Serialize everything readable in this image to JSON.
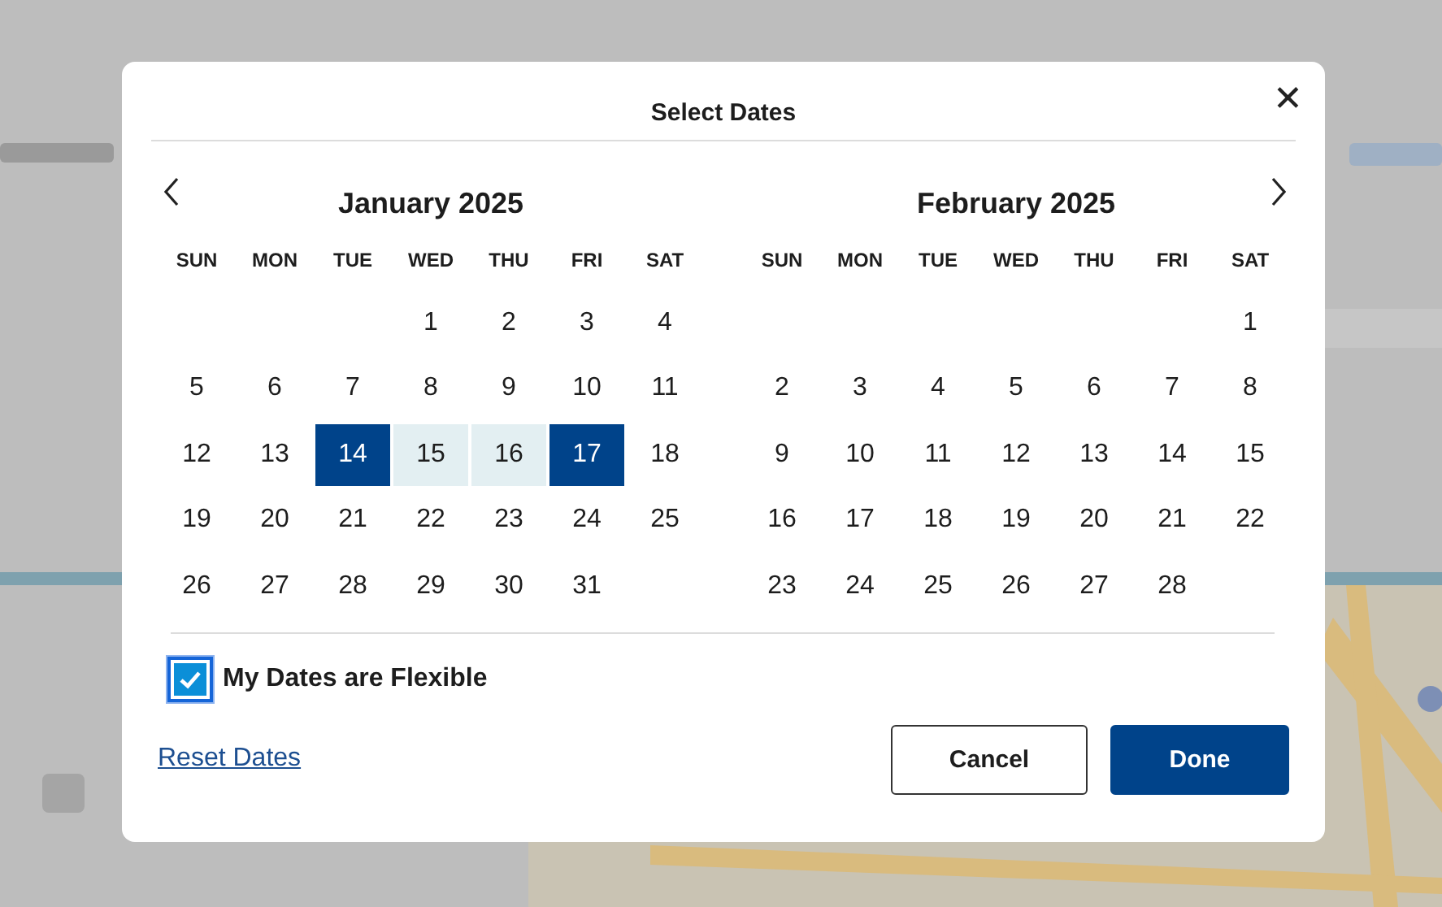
{
  "dialog": {
    "title": "Select Dates",
    "close_label": "✕"
  },
  "calendars": [
    {
      "title": "January 2025",
      "weekdays": [
        "SUN",
        "MON",
        "TUE",
        "WED",
        "THU",
        "FRI",
        "SAT"
      ],
      "weeks": [
        [
          {
            "kind": "blank"
          },
          {
            "kind": "blank"
          },
          {
            "kind": "blank"
          },
          {
            "kind": "day",
            "day": "1",
            "selected": false,
            "in_range": false
          },
          {
            "kind": "day",
            "day": "2",
            "selected": false,
            "in_range": false
          },
          {
            "kind": "day",
            "day": "3",
            "selected": false,
            "in_range": false
          },
          {
            "kind": "day",
            "day": "4",
            "selected": false,
            "in_range": false
          }
        ],
        [
          {
            "kind": "day",
            "day": "5",
            "selected": false,
            "in_range": false
          },
          {
            "kind": "day",
            "day": "6",
            "selected": false,
            "in_range": false
          },
          {
            "kind": "day",
            "day": "7",
            "selected": false,
            "in_range": false
          },
          {
            "kind": "day",
            "day": "8",
            "selected": false,
            "in_range": false
          },
          {
            "kind": "day",
            "day": "9",
            "selected": false,
            "in_range": false
          },
          {
            "kind": "day",
            "day": "10",
            "selected": false,
            "in_range": false
          },
          {
            "kind": "day",
            "day": "11",
            "selected": false,
            "in_range": false
          }
        ],
        [
          {
            "kind": "day",
            "day": "12",
            "selected": false,
            "in_range": false
          },
          {
            "kind": "day",
            "day": "13",
            "selected": false,
            "in_range": false
          },
          {
            "kind": "day",
            "day": "14",
            "selected": true,
            "in_range": false
          },
          {
            "kind": "day",
            "day": "15",
            "selected": false,
            "in_range": true
          },
          {
            "kind": "day",
            "day": "16",
            "selected": false,
            "in_range": true
          },
          {
            "kind": "day",
            "day": "17",
            "selected": true,
            "in_range": false
          },
          {
            "kind": "day",
            "day": "18",
            "selected": false,
            "in_range": false
          }
        ],
        [
          {
            "kind": "day",
            "day": "19",
            "selected": false,
            "in_range": false
          },
          {
            "kind": "day",
            "day": "20",
            "selected": false,
            "in_range": false
          },
          {
            "kind": "day",
            "day": "21",
            "selected": false,
            "in_range": false
          },
          {
            "kind": "day",
            "day": "22",
            "selected": false,
            "in_range": false
          },
          {
            "kind": "day",
            "day": "23",
            "selected": false,
            "in_range": false
          },
          {
            "kind": "day",
            "day": "24",
            "selected": false,
            "in_range": false
          },
          {
            "kind": "day",
            "day": "25",
            "selected": false,
            "in_range": false
          }
        ],
        [
          {
            "kind": "day",
            "day": "26",
            "selected": false,
            "in_range": false
          },
          {
            "kind": "day",
            "day": "27",
            "selected": false,
            "in_range": false
          },
          {
            "kind": "day",
            "day": "28",
            "selected": false,
            "in_range": false
          },
          {
            "kind": "day",
            "day": "29",
            "selected": false,
            "in_range": false
          },
          {
            "kind": "day",
            "day": "30",
            "selected": false,
            "in_range": false
          },
          {
            "kind": "day",
            "day": "31",
            "selected": false,
            "in_range": false
          },
          {
            "kind": "blank"
          }
        ]
      ]
    },
    {
      "title": "February 2025",
      "weekdays": [
        "SUN",
        "MON",
        "TUE",
        "WED",
        "THU",
        "FRI",
        "SAT"
      ],
      "weeks": [
        [
          {
            "kind": "blank"
          },
          {
            "kind": "blank"
          },
          {
            "kind": "blank"
          },
          {
            "kind": "blank"
          },
          {
            "kind": "blank"
          },
          {
            "kind": "blank"
          },
          {
            "kind": "day",
            "day": "1",
            "selected": false,
            "in_range": false
          }
        ],
        [
          {
            "kind": "day",
            "day": "2",
            "selected": false,
            "in_range": false
          },
          {
            "kind": "day",
            "day": "3",
            "selected": false,
            "in_range": false
          },
          {
            "kind": "day",
            "day": "4",
            "selected": false,
            "in_range": false
          },
          {
            "kind": "day",
            "day": "5",
            "selected": false,
            "in_range": false
          },
          {
            "kind": "day",
            "day": "6",
            "selected": false,
            "in_range": false
          },
          {
            "kind": "day",
            "day": "7",
            "selected": false,
            "in_range": false
          },
          {
            "kind": "day",
            "day": "8",
            "selected": false,
            "in_range": false
          }
        ],
        [
          {
            "kind": "day",
            "day": "9",
            "selected": false,
            "in_range": false
          },
          {
            "kind": "day",
            "day": "10",
            "selected": false,
            "in_range": false
          },
          {
            "kind": "day",
            "day": "11",
            "selected": false,
            "in_range": false
          },
          {
            "kind": "day",
            "day": "12",
            "selected": false,
            "in_range": false
          },
          {
            "kind": "day",
            "day": "13",
            "selected": false,
            "in_range": false
          },
          {
            "kind": "day",
            "day": "14",
            "selected": false,
            "in_range": false
          },
          {
            "kind": "day",
            "day": "15",
            "selected": false,
            "in_range": false
          }
        ],
        [
          {
            "kind": "day",
            "day": "16",
            "selected": false,
            "in_range": false
          },
          {
            "kind": "day",
            "day": "17",
            "selected": false,
            "in_range": false
          },
          {
            "kind": "day",
            "day": "18",
            "selected": false,
            "in_range": false
          },
          {
            "kind": "day",
            "day": "19",
            "selected": false,
            "in_range": false
          },
          {
            "kind": "day",
            "day": "20",
            "selected": false,
            "in_range": false
          },
          {
            "kind": "day",
            "day": "21",
            "selected": false,
            "in_range": false
          },
          {
            "kind": "day",
            "day": "22",
            "selected": false,
            "in_range": false
          }
        ],
        [
          {
            "kind": "day",
            "day": "23",
            "selected": false,
            "in_range": false
          },
          {
            "kind": "day",
            "day": "24",
            "selected": false,
            "in_range": false
          },
          {
            "kind": "day",
            "day": "25",
            "selected": false,
            "in_range": false
          },
          {
            "kind": "day",
            "day": "26",
            "selected": false,
            "in_range": false
          },
          {
            "kind": "day",
            "day": "27",
            "selected": false,
            "in_range": false
          },
          {
            "kind": "day",
            "day": "28",
            "selected": false,
            "in_range": false
          },
          {
            "kind": "blank"
          }
        ]
      ]
    }
  ],
  "flexible": {
    "label": "My Dates are Flexible",
    "checked": true
  },
  "reset_link": "Reset Dates",
  "buttons": [
    {
      "label": "Cancel",
      "kind": "secondary"
    },
    {
      "label": "Done",
      "kind": "primary"
    }
  ]
}
